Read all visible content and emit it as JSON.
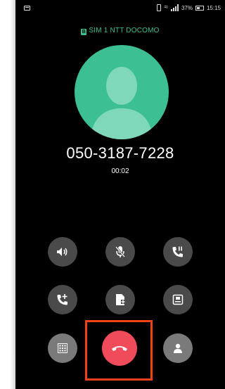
{
  "status_bar": {
    "battery_text": "37%",
    "time": "15:15"
  },
  "sim": {
    "badge": "B",
    "label": "SIM 1  NTT DOCOMO"
  },
  "call": {
    "number": "050-3187-7228",
    "duration": "00:02"
  },
  "buttons": [
    {
      "name": "speaker-button",
      "icon": "speaker-icon"
    },
    {
      "name": "mute-button",
      "icon": "mic-off-icon"
    },
    {
      "name": "hold-button",
      "icon": "hold-call-icon"
    },
    {
      "name": "add-call-button",
      "icon": "add-call-icon"
    },
    {
      "name": "contacts-button",
      "icon": "contact-card-icon"
    },
    {
      "name": "record-button",
      "icon": "record-icon"
    },
    {
      "name": "keypad-button",
      "icon": "keypad-icon"
    },
    {
      "name": "end-call-button",
      "icon": "end-call-icon"
    },
    {
      "name": "profile-button",
      "icon": "person-icon"
    }
  ],
  "colors": {
    "accent": "#3bbf93",
    "end_call": "#ef4b5a",
    "highlight": "#f04216"
  }
}
